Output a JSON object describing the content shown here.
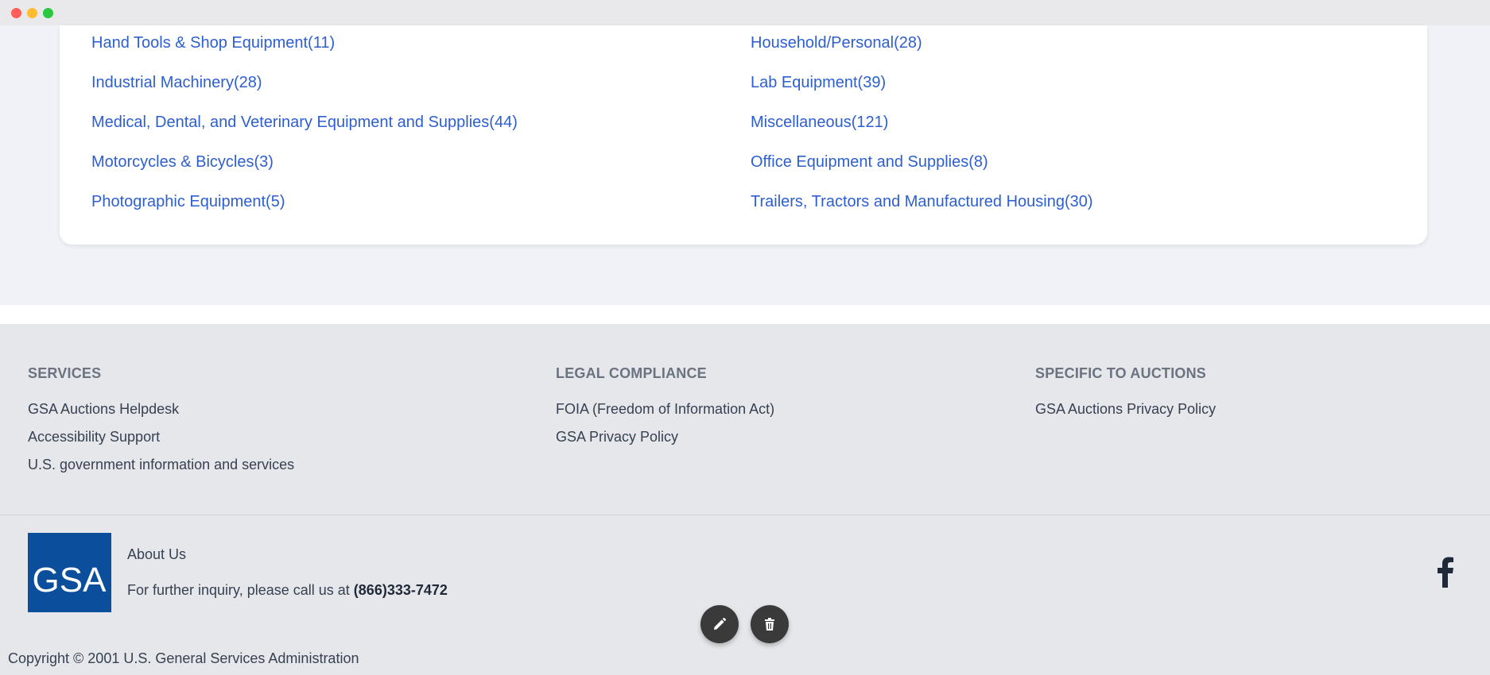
{
  "categories": [
    {
      "label": "Hand Tools & Shop Equipment(11)"
    },
    {
      "label": "Household/Personal(28)"
    },
    {
      "label": "Industrial Machinery(28)"
    },
    {
      "label": "Lab Equipment(39)"
    },
    {
      "label": "Medical, Dental, and Veterinary Equipment and Supplies(44)"
    },
    {
      "label": "Miscellaneous(121)"
    },
    {
      "label": "Motorcycles & Bicycles(3)"
    },
    {
      "label": "Office Equipment and Supplies(8)"
    },
    {
      "label": "Photographic Equipment(5)"
    },
    {
      "label": "Trailers, Tractors and Manufactured Housing(30)"
    }
  ],
  "footer": {
    "services": {
      "title": "SERVICES",
      "links": [
        "GSA Auctions Helpdesk",
        "Accessibility Support",
        "U.S. government information and services"
      ]
    },
    "legal": {
      "title": "LEGAL COMPLIANCE",
      "links": [
        "FOIA (Freedom of Information Act)",
        "GSA Privacy Policy"
      ]
    },
    "auctions": {
      "title": "SPECIFIC TO AUCTIONS",
      "links": [
        "GSA Auctions Privacy Policy"
      ]
    },
    "logo_text": "GSA",
    "about": "About Us",
    "inquiry_prefix": "For further inquiry, please call us at ",
    "phone": "(866)333-7472",
    "copyright": "Copyright © 2001 U.S. General Services Administration"
  },
  "colors": {
    "link": "#2d5fd0",
    "footer_bg": "#e5e7eb",
    "logo_bg": "#0b4f9c",
    "fab_bg": "#3a3a3a"
  },
  "icons": {
    "edit": "pencil-icon",
    "delete": "trash-icon",
    "social": "facebook-icon"
  }
}
